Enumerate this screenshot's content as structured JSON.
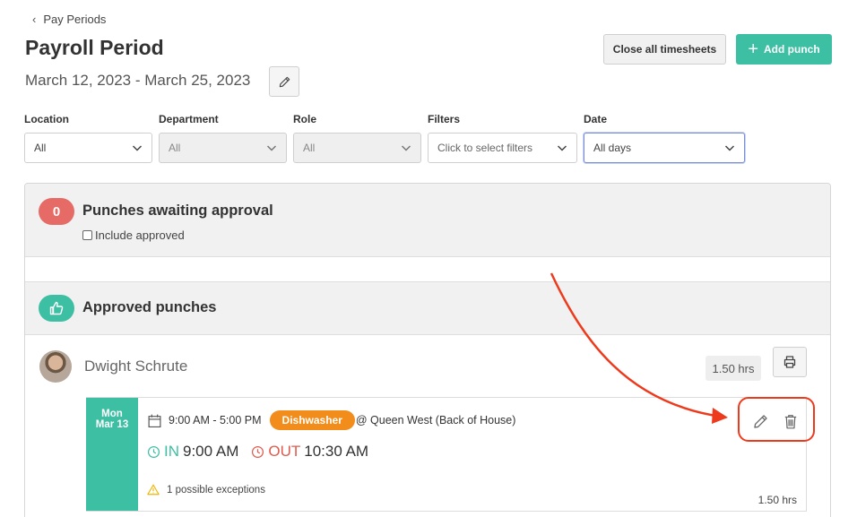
{
  "nav": {
    "back_label": "Pay Periods"
  },
  "page": {
    "title": "Payroll Period",
    "date_range": "March 12, 2023 - March 25, 2023"
  },
  "actions": {
    "close_all_label": "Close all timesheets",
    "add_punch_label": "Add punch"
  },
  "filters": [
    {
      "label": "Location",
      "value": "All"
    },
    {
      "label": "Department",
      "value": "All"
    },
    {
      "label": "Role",
      "value": "All"
    },
    {
      "label": "Filters",
      "value": "Click to select filters"
    },
    {
      "label": "Date",
      "value": "All days"
    }
  ],
  "awaiting": {
    "count": "0",
    "title": "Punches awaiting approval",
    "include_label": "Include approved"
  },
  "approved": {
    "title": "Approved punches"
  },
  "employee": {
    "name": "Dwight Schrute",
    "total_hours": "1.50 hrs"
  },
  "punch": {
    "day": "Mon",
    "date": "Mar 13",
    "shift_time": "9:00 AM - 5:00 PM",
    "role": "Dishwasher",
    "location": "@ Queen West (Back of House)",
    "in_label": "IN",
    "in_time": "9:00 AM",
    "out_label": "OUT",
    "out_time": "10:30 AM",
    "exceptions": "1 possible exceptions",
    "hours": "1.50 hrs"
  },
  "colors": {
    "accent": "#3dbfa3",
    "danger": "#e66a66",
    "role": "#f28c1b",
    "annotation": "#ee3a1c"
  }
}
